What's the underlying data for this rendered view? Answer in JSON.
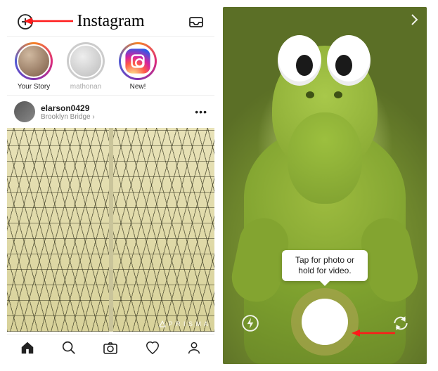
{
  "feed": {
    "app_name": "Instagram",
    "stories": [
      {
        "label": "Your Story",
        "ring": "grad",
        "avatar": "generic"
      },
      {
        "label": "mathonan",
        "ring": "grey",
        "avatar": "grey",
        "faded": true
      },
      {
        "label": "New!",
        "ring": "grad",
        "avatar": "iglogo"
      }
    ],
    "post": {
      "username": "elarson0429",
      "location": "Brooklyn Bridge",
      "watermark": "P R I S M A"
    },
    "icons": {
      "add_story": "⊕",
      "inbox": "✉",
      "more": "•••"
    }
  },
  "camera": {
    "tooltip": "Tap for photo or hold for video."
  },
  "annotations": {
    "arrow_left_target": "add-story-button",
    "arrow_right_target": "shutter-button"
  }
}
